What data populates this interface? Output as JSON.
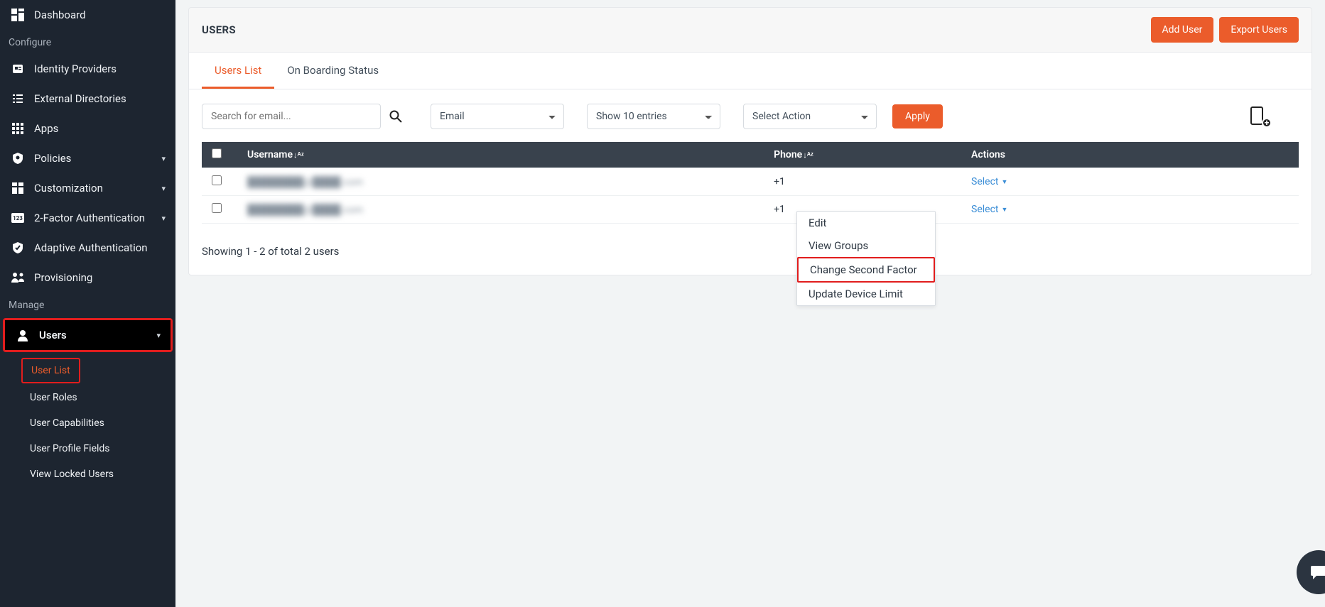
{
  "sidebar": {
    "items": [
      {
        "label": "Dashboard",
        "icon": "dashboard-icon"
      }
    ],
    "sections": {
      "configure": {
        "label": "Configure",
        "items": [
          {
            "label": "Identity Providers",
            "icon": "idp-icon",
            "expandable": false
          },
          {
            "label": "External Directories",
            "icon": "list-icon",
            "expandable": false
          },
          {
            "label": "Apps",
            "icon": "apps-icon",
            "expandable": false
          },
          {
            "label": "Policies",
            "icon": "shield-icon",
            "expandable": true
          },
          {
            "label": "Customization",
            "icon": "customize-icon",
            "expandable": true
          },
          {
            "label": "2-Factor Authentication",
            "icon": "2fa-icon",
            "expandable": true
          },
          {
            "label": "Adaptive Authentication",
            "icon": "verified-icon",
            "expandable": false
          },
          {
            "label": "Provisioning",
            "icon": "provisioning-icon",
            "expandable": false
          }
        ]
      },
      "manage": {
        "label": "Manage",
        "items": [
          {
            "label": "Users",
            "icon": "user-icon",
            "expandable": true,
            "active": true,
            "children": [
              {
                "label": "User List",
                "active": true
              },
              {
                "label": "User Roles"
              },
              {
                "label": "User Capabilities"
              },
              {
                "label": "User Profile Fields"
              },
              {
                "label": "View Locked Users"
              }
            ]
          }
        ]
      }
    }
  },
  "header": {
    "title": "USERS",
    "add_user": "Add User",
    "export_users": "Export Users"
  },
  "tabs": {
    "users_list": "Users List",
    "onboarding": "On Boarding Status"
  },
  "toolbar": {
    "search_placeholder": "Search for email...",
    "field_select": "Email",
    "entries_select": "Show 10 entries",
    "action_select": "Select Action",
    "apply": "Apply"
  },
  "table": {
    "columns": {
      "username": "Username",
      "phone": "Phone",
      "actions": "Actions"
    },
    "rows": [
      {
        "username": "████████@████.com",
        "phone": "+1",
        "action": "Select"
      },
      {
        "username": "████████@████.com",
        "phone": "+1",
        "action": "Select"
      }
    ],
    "summary": "Showing 1 - 2 of total 2 users"
  },
  "dropdown": {
    "edit": "Edit",
    "view_groups": "View Groups",
    "change_second_factor": "Change Second Factor",
    "update_device_limit": "Update Device Limit"
  }
}
